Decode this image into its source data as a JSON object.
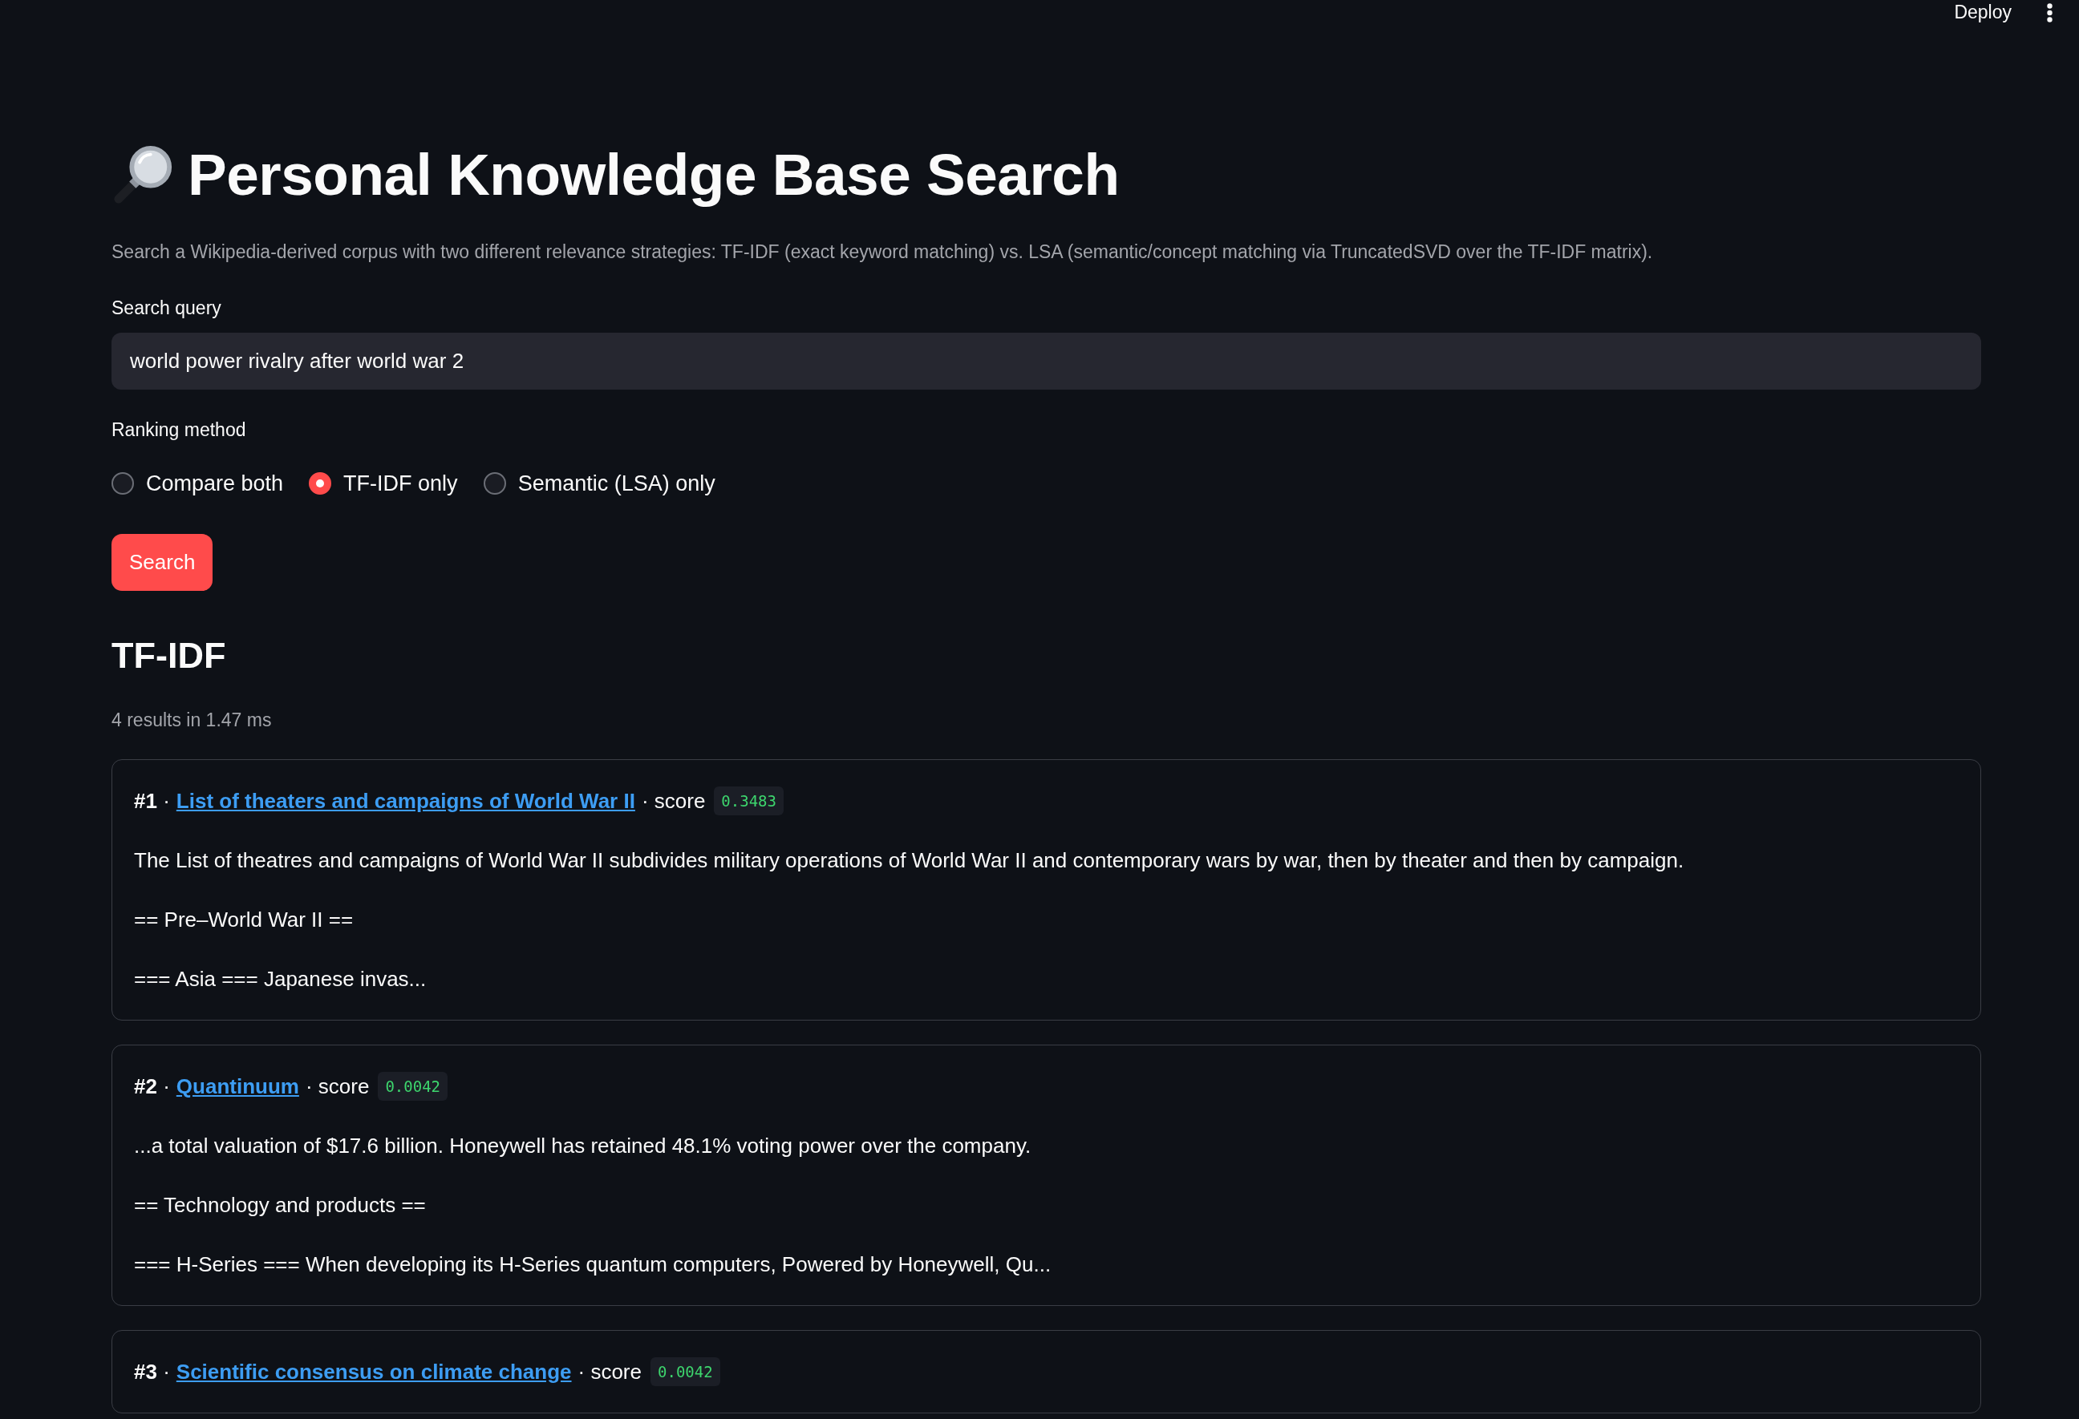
{
  "header": {
    "deploy_label": "Deploy"
  },
  "title": {
    "text": "Personal Knowledge Base Search"
  },
  "description": "Search a Wikipedia-derived corpus with two different relevance strategies: TF-IDF (exact keyword matching) vs. LSA (semantic/concept matching via TruncatedSVD over the TF-IDF matrix).",
  "search": {
    "label": "Search query",
    "value": "world power rivalry after world war 2"
  },
  "ranking": {
    "label": "Ranking method",
    "options": [
      {
        "label": "Compare both",
        "selected": false
      },
      {
        "label": "TF-IDF only",
        "selected": true
      },
      {
        "label": "Semantic (LSA) only",
        "selected": false
      }
    ]
  },
  "search_button": "Search",
  "results_section": {
    "heading": "TF-IDF",
    "summary": "4 results in 1.47 ms",
    "results": [
      {
        "rank": "**#1** ·",
        "title": "List of theaters and campaigns of World War II",
        "score_label": "· score",
        "score": "0.3483",
        "snippet": [
          "The List of theatres and campaigns of World War II subdivides military operations of World War II and contemporary wars by war, then by theater and then by campaign.",
          "== Pre–World War II ==",
          "=== Asia === Japanese invas..."
        ]
      },
      {
        "rank": "**#2** ·",
        "title": "Quantinuum",
        "score_label": "· score",
        "score": "0.0042",
        "snippet": [
          "...a total valuation of $17.6 billion. Honeywell has retained 48.1% voting power over the company.",
          "== Technology and products ==",
          "=== H-Series === When developing its H-Series quantum computers, Powered by Honeywell, Qu..."
        ]
      },
      {
        "rank": "**#3** ·",
        "title": "Scientific consensus on climate change",
        "score_label": "· score",
        "score": "0.0042"
      }
    ]
  }
}
